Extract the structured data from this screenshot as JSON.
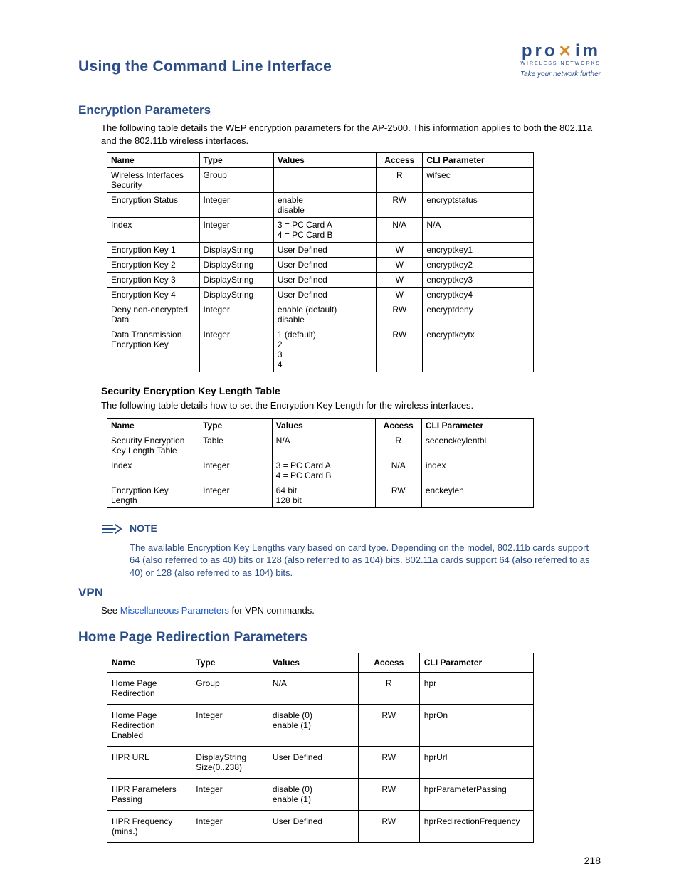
{
  "logo": {
    "name": "proxim",
    "sub1": "WIRELESS NETWORKS",
    "sub2": "Take your network further"
  },
  "pageTitle": "Using the Command Line Interface",
  "s1": {
    "heading": "Encryption Parameters",
    "intro": "The following table details the WEP encryption parameters for the AP-2500. This information applies to both the 802.11a and the 802.11b wireless interfaces.",
    "cols": {
      "c1": "Name",
      "c2": "Type",
      "c3": "Values",
      "c4": "Access",
      "c5": "CLI Parameter"
    },
    "rows": [
      {
        "name": "Wireless Interfaces Security",
        "type": "Group",
        "values": "",
        "access": "R",
        "cli": "wifsec"
      },
      {
        "name": "Encryption Status",
        "type": "Integer",
        "values": "enable\ndisable",
        "access": "RW",
        "cli": "encryptstatus"
      },
      {
        "name": "Index",
        "type": "Integer",
        "values": "3 = PC Card A\n4 = PC Card B",
        "access": "N/A",
        "cli": "N/A"
      },
      {
        "name": "Encryption Key 1",
        "type": "DisplayString",
        "values": "User Defined",
        "access": "W",
        "cli": "encryptkey1"
      },
      {
        "name": "Encryption Key 2",
        "type": "DisplayString",
        "values": "User Defined",
        "access": "W",
        "cli": "encryptkey2"
      },
      {
        "name": "Encryption Key 3",
        "type": "DisplayString",
        "values": "User Defined",
        "access": "W",
        "cli": "encryptkey3"
      },
      {
        "name": "Encryption Key 4",
        "type": "DisplayString",
        "values": "User Defined",
        "access": "W",
        "cli": "encryptkey4"
      },
      {
        "name": "Deny non-encrypted Data",
        "type": "Integer",
        "values": "enable (default)\ndisable",
        "access": "RW",
        "cli": "encryptdeny"
      },
      {
        "name": "Data Transmission Encryption Key",
        "type": "Integer",
        "values": "1 (default)\n2\n3\n4",
        "access": "RW",
        "cli": "encryptkeytx"
      }
    ]
  },
  "s2": {
    "heading": "Security Encryption Key Length Table",
    "intro": "The following table details how to set the Encryption Key Length for the wireless interfaces.",
    "cols": {
      "c1": "Name",
      "c2": "Type",
      "c3": "Values",
      "c4": "Access",
      "c5": "CLI Parameter"
    },
    "rows": [
      {
        "name": "Security Encryption Key Length Table",
        "type": "Table",
        "values": "N/A",
        "access": "R",
        "cli": "secenckeylentbl"
      },
      {
        "name": "Index",
        "type": "Integer",
        "values": "3 = PC Card A\n4 = PC Card B",
        "access": "N/A",
        "cli": "index"
      },
      {
        "name": "Encryption Key Length",
        "type": "Integer",
        "values": "64 bit\n128 bit",
        "access": "RW",
        "cli": "enckeylen"
      }
    ]
  },
  "note": {
    "label": "NOTE",
    "body": "The available Encryption Key Lengths vary based on card type. Depending on the model, 802.11b cards support 64 (also referred to as 40) bits or 128 (also referred to as 104) bits. 802.11a cards support 64 (also referred to as 40) or 128 (also referred to as 104) bits."
  },
  "vpn": {
    "heading": "VPN",
    "pre": "See ",
    "link": "Miscellaneous Parameters",
    "post": " for VPN commands."
  },
  "s3": {
    "heading": "Home Page Redirection Parameters",
    "cols": {
      "c1": "Name",
      "c2": "Type",
      "c3": "Values",
      "c4": "Access",
      "c5": "CLI Parameter"
    },
    "rows": [
      {
        "name": "Home Page Redirection",
        "type": "Group",
        "values": "N/A",
        "access": "R",
        "cli": "hpr"
      },
      {
        "name": "Home Page Redirection Enabled",
        "type": "Integer",
        "values": "disable (0)\nenable (1)",
        "access": "RW",
        "cli": "hprOn"
      },
      {
        "name": "HPR URL",
        "type": "DisplayString Size(0..238)",
        "values": "User Defined",
        "access": "RW",
        "cli": "hprUrl"
      },
      {
        "name": "HPR Parameters Passing",
        "type": "Integer",
        "values": "disable (0)\nenable (1)",
        "access": "RW",
        "cli": "hprParameterPassing"
      },
      {
        "name": "HPR Frequency (mins.)",
        "type": "Integer",
        "values": "User Defined",
        "access": "RW",
        "cli": "hprRedirectionFrequency"
      }
    ]
  },
  "pageNumber": "218"
}
